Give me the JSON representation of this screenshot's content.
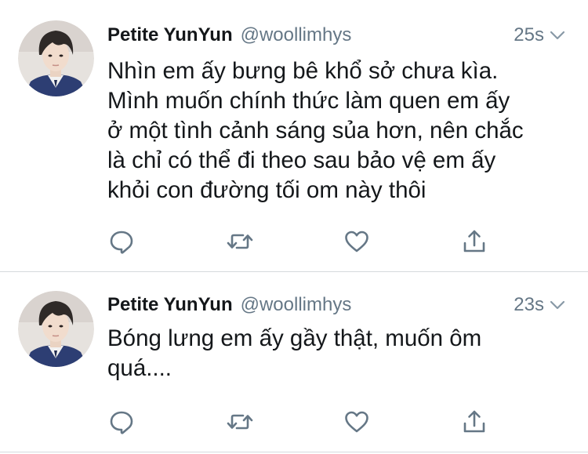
{
  "colors": {
    "text": "#14171a",
    "secondary": "#657786",
    "icon": "#657786",
    "divider": "#d6dadd"
  },
  "tweets": [
    {
      "display_name": "Petite YunYun",
      "handle": "@woollimhys",
      "time": "25s",
      "text_lines": [
        "Nhìn em ấy bưng bê khổ sở chưa kìa.",
        "Mình muốn chính thức làm quen em ấy",
        "ở một tình cảnh sáng sủa hơn, nên chắc",
        "là chỉ có thể đi theo sau bảo vệ em ấy",
        "khỏi con đường tối om này thôi"
      ],
      "actions": [
        "reply-icon",
        "retweet-icon",
        "like-icon",
        "share-icon"
      ]
    },
    {
      "display_name": "Petite YunYun",
      "handle": "@woollimhys",
      "time": "23s",
      "text_lines": [
        "Bóng lưng em ấy gầy thật, muốn ôm",
        "quá...."
      ],
      "actions": [
        "reply-icon",
        "retweet-icon",
        "like-icon",
        "share-icon"
      ]
    }
  ]
}
